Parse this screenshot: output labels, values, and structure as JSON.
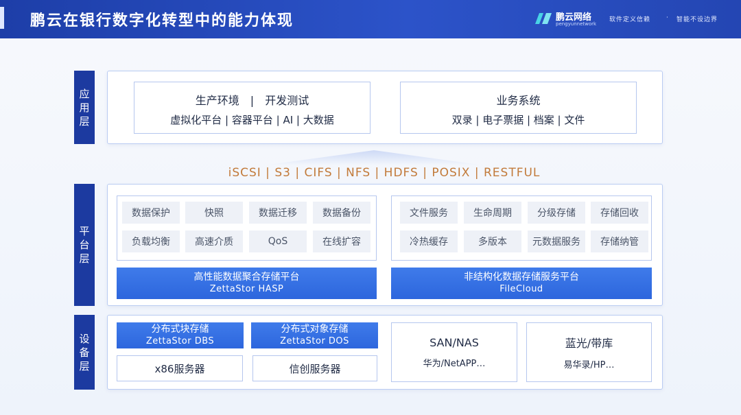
{
  "header": {
    "title": "鹏云在银行数字化转型中的能力体现",
    "brand_name": "鹏云网络",
    "brand_sub": "pengyunnetwork",
    "slogan": "软件定义信赖",
    "separator": "·",
    "slogan2": "智能不设边界"
  },
  "layers": {
    "app": "应用层",
    "platform": "平台层",
    "device": "设备层"
  },
  "app_layer": {
    "left_line1": "生产环境　|　开发测试",
    "left_line2": "虚拟化平台 | 容器平台 | AI | 大数据",
    "right_line1": "业务系统",
    "right_line2": "双录 | 电子票据 | 档案 | 文件"
  },
  "protocols": "iSCSI | S3 | CIFS | NFS | HDFS | POSIX | RESTFUL",
  "platform_layer": {
    "left_cells": [
      "数据保护",
      "快照",
      "数据迁移",
      "数据备份",
      "负载均衡",
      "高速介质",
      "QoS",
      "在线扩容"
    ],
    "left_bar_title": "高性能数据聚合存储平台",
    "left_bar_sub": "ZettaStor HASP",
    "right_cells": [
      "文件服务",
      "生命周期",
      "分级存储",
      "存储回收",
      "冷热缓存",
      "多版本",
      "元数据服务",
      "存储纳管"
    ],
    "right_bar_title": "非结构化数据存储服务平台",
    "right_bar_sub": "FileCloud"
  },
  "device_layer": {
    "block_title": "分布式块存储",
    "block_sub": "ZettaStor DBS",
    "object_title": "分布式对象存储",
    "object_sub": "ZettaStor DOS",
    "x86": "x86服务器",
    "xinchuang": "信创服务器",
    "san_title": "SAN/NAS",
    "san_sub": "华为/NetAPP…",
    "tape_title": "蓝光/带库",
    "tape_sub": "易华录/HP…"
  },
  "colors": {
    "header_blue": "#1d3ea8",
    "layer_tab": "#1c3aa0",
    "bar_blue": "#2d66dd",
    "protocol_orange": "#c27a3a"
  }
}
